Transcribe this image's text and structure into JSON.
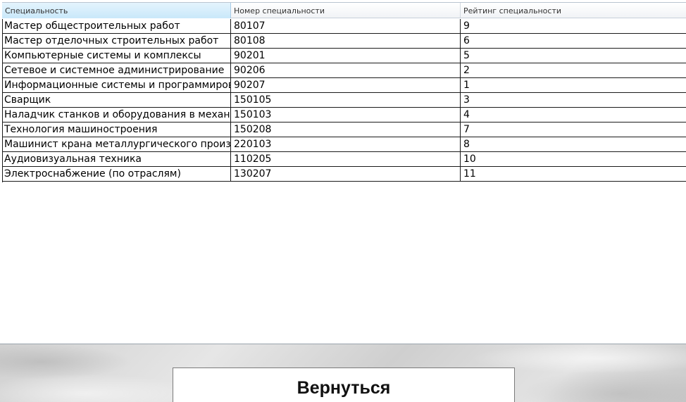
{
  "table": {
    "columns": [
      "Специальность",
      "Номер специальности",
      "Рейтинг специальности"
    ],
    "rows": [
      {
        "name": "Мастер общестроительных работ",
        "number": "80107",
        "rating": "9"
      },
      {
        "name": "Мастер отделочных строительных работ",
        "number": "80108",
        "rating": "6"
      },
      {
        "name": "Компьютерные системы и комплексы",
        "number": "90201",
        "rating": "5"
      },
      {
        "name": "Сетевое и системное администрирование",
        "number": "90206",
        "rating": "2"
      },
      {
        "name": "Информационные системы и программирование",
        "number": "90207",
        "rating": "1"
      },
      {
        "name": "Сварщик",
        "number": "150105",
        "rating": "3"
      },
      {
        "name": "Наладчик станков и оборудования в механообработке",
        "number": "150103",
        "rating": "4"
      },
      {
        "name": "Технология машиностроения",
        "number": "150208",
        "rating": "7"
      },
      {
        "name": "Машинист крана металлургического производства",
        "number": "220103",
        "rating": "8"
      },
      {
        "name": "Аудиовизуальная техника",
        "number": "110205",
        "rating": "10"
      },
      {
        "name": "Электроснабжение (по отраслям)",
        "number": "130207",
        "rating": "11"
      }
    ]
  },
  "footer": {
    "back_label": "Вернуться"
  },
  "colors": {
    "sorted_header": "#c9e8fa",
    "grid_line": "#1a1a1a"
  }
}
